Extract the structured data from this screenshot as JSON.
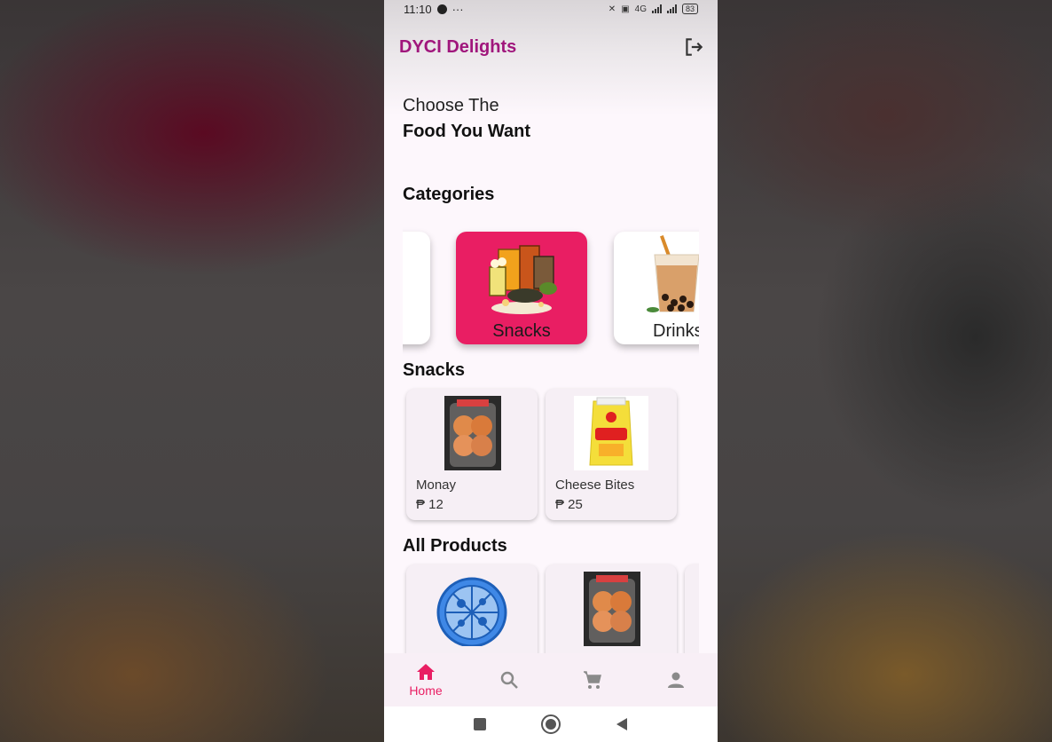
{
  "status_bar": {
    "time": "11:10",
    "dots": "···",
    "network": "4G",
    "battery": "83"
  },
  "app_bar": {
    "title": "DYCI Delights"
  },
  "headline": {
    "line1": "Choose The",
    "line2": "Food You Want"
  },
  "categories": {
    "title": "Categories",
    "items": [
      {
        "label": "",
        "state": "partial"
      },
      {
        "label": "Snacks",
        "state": "selected"
      },
      {
        "label": "Drinks",
        "state": "partial"
      }
    ]
  },
  "snacks": {
    "title": "Snacks",
    "items": [
      {
        "name": "Monay",
        "price": "₱ 12"
      },
      {
        "name": "Cheese Bites",
        "price": "₱ 25"
      }
    ]
  },
  "all_products": {
    "title": "All Products"
  },
  "bottom_nav": {
    "home_label": "Home",
    "accent": "#e91e63",
    "inactive": "#8a8a8a"
  },
  "colors": {
    "brand": "#a0167c",
    "category_selected": "#e91e63",
    "background": "#fdf7fc"
  }
}
